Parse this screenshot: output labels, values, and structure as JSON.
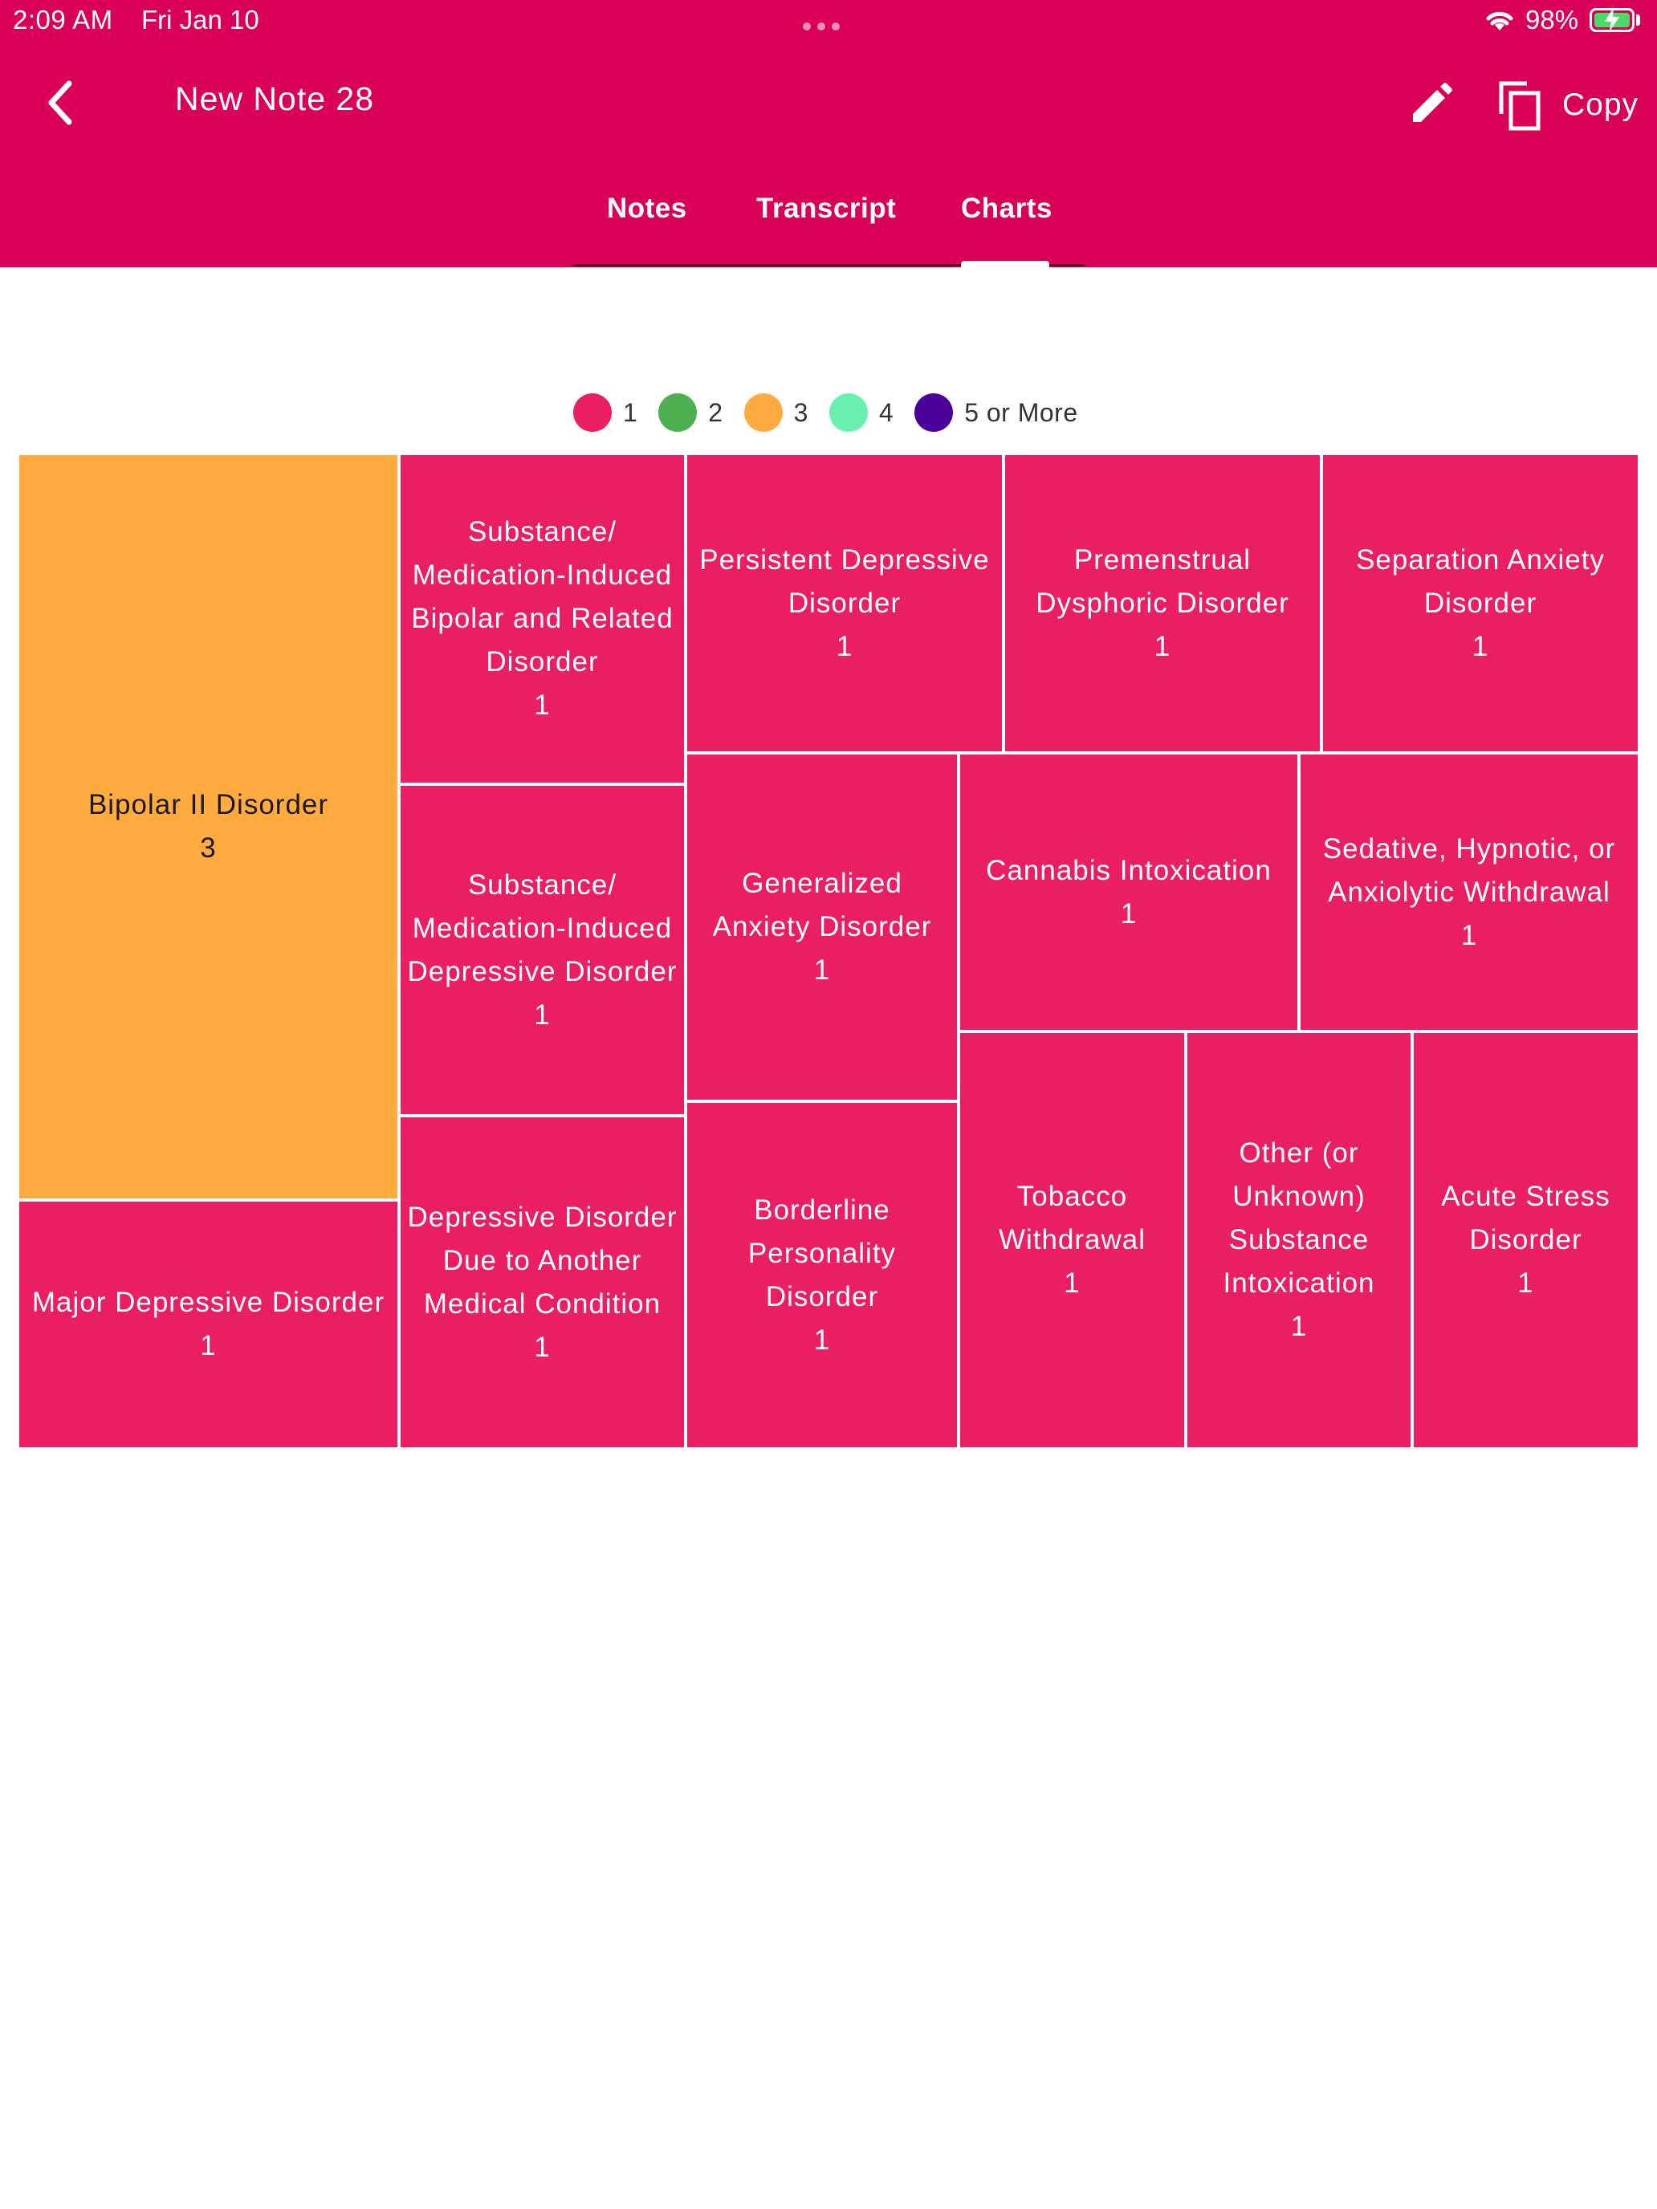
{
  "status_bar": {
    "time": "2:09 AM",
    "date": "Fri Jan 10",
    "battery": "98%",
    "icons": [
      "multitasking-dots-icon",
      "wifi-icon",
      "battery-charging-icon"
    ]
  },
  "header": {
    "title": "New Note 28",
    "back_icon": "chevron-left-icon",
    "edit_icon": "pencil-icon",
    "copy_icon": "copy-icon",
    "copy_label": "Copy"
  },
  "tabs": [
    {
      "label": "Notes"
    },
    {
      "label": "Transcript"
    },
    {
      "label": "Charts",
      "selected": true
    }
  ],
  "colors": {
    "brand": "#d90057",
    "count_1": "#e91e63",
    "count_2": "#4caf50",
    "count_3": "#ffab40",
    "count_4": "#69f0ae",
    "count_5_plus": "#4a0099"
  },
  "legend": [
    {
      "label": "1",
      "color": "#e91e63"
    },
    {
      "label": "2",
      "color": "#4caf50"
    },
    {
      "label": "3",
      "color": "#ffab40"
    },
    {
      "label": "4",
      "color": "#69f0ae"
    },
    {
      "label": "5 or More",
      "color": "#4a0099"
    }
  ],
  "chart_data": {
    "type": "treemap",
    "items": [
      {
        "label": "Bipolar II Disorder",
        "value": 3
      },
      {
        "label": "Major Depressive Disorder",
        "value": 1
      },
      {
        "label": "Substance/\nMedication-Induced\nBipolar and Related\nDisorder",
        "value": 1
      },
      {
        "label": "Substance/\nMedication-Induced\nDepressive Disorder",
        "value": 1
      },
      {
        "label": "Depressive Disorder\nDue to Another\nMedical Condition",
        "value": 1
      },
      {
        "label": "Persistent Depressive\nDisorder",
        "value": 1
      },
      {
        "label": "Premenstrual\nDysphoric Disorder",
        "value": 1
      },
      {
        "label": "Separation Anxiety\nDisorder",
        "value": 1
      },
      {
        "label": "Generalized\nAnxiety Disorder",
        "value": 1
      },
      {
        "label": "Cannabis Intoxication",
        "value": 1
      },
      {
        "label": "Sedative, Hypnotic, or\nAnxiolytic Withdrawal",
        "value": 1
      },
      {
        "label": "Borderline\nPersonality\nDisorder",
        "value": 1
      },
      {
        "label": "Tobacco\nWithdrawal",
        "value": 1
      },
      {
        "label": "Other (or\nUnknown)\nSubstance\nIntoxication",
        "value": 1
      },
      {
        "label": "Acute Stress\nDisorder",
        "value": 1
      }
    ]
  }
}
